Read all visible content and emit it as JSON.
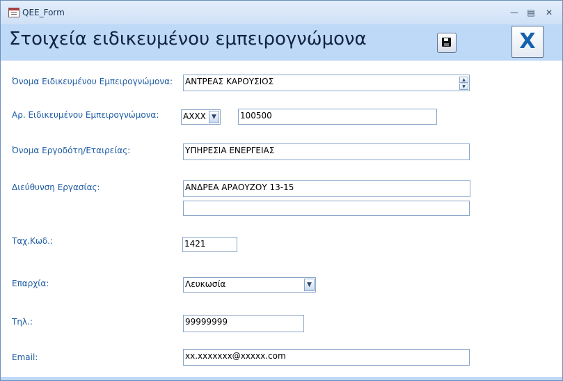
{
  "window": {
    "title": "QEE_Form",
    "minimize_icon": "minimize-icon",
    "maximize_icon": "maximize-icon",
    "close_icon": "close-icon"
  },
  "header": {
    "title": "Στοιχεία ειδικευμένου εμπειρογνώμονα",
    "save_icon": "save-icon",
    "close_label": "X"
  },
  "fields": {
    "name": {
      "label": "Όνομα Ειδικευμένου Εμπειρογνώμονα:",
      "value": "ΑΝΤΡΕΑΣ ΚΑΡΟΥΣΙΟΣ"
    },
    "number": {
      "label": "Αρ.  Ειδικευμένου Εμπειρογνώμονα:",
      "prefix": "AXXX",
      "value": "100500"
    },
    "employer": {
      "label": "Όνομα Εργοδότη/Εταιρείας:",
      "value": "ΥΠΗΡΕΣΙΑ ΕΝΕΡΓΕΙΑΣ"
    },
    "address": {
      "label": "Διεύθυνση Εργασίας:",
      "line1": "ΑΝΔΡΕΑ ΑΡΑΟΥΖΟΥ 13-15",
      "line2": ""
    },
    "postal_code": {
      "label": "Ταχ.Κωδ.:",
      "value": "1421"
    },
    "district": {
      "label": "Επαρχία:",
      "value": "Λευκωσία"
    },
    "phone": {
      "label": "Τηλ.:",
      "value": "99999999"
    },
    "email": {
      "label": "Email:",
      "value": "xx.xxxxxxx@xxxxx.com"
    }
  },
  "colors": {
    "header_bg": "#bed8f7",
    "label": "#1d5aa3",
    "close_x": "#1462ad"
  }
}
